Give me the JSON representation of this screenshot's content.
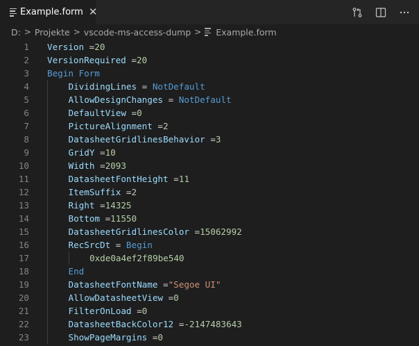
{
  "tab": {
    "label": "Example.form",
    "file_icon": "file-lines-icon",
    "close_icon": "close-icon"
  },
  "actions": [
    {
      "name": "compare-changes-icon"
    },
    {
      "name": "split-editor-icon"
    },
    {
      "name": "more-actions-icon"
    }
  ],
  "breadcrumb": {
    "items": [
      "D:",
      "Projekte",
      "vscode-ms-access-dump",
      "Example.form"
    ],
    "separator": ">"
  },
  "colors": {
    "key": "#9cdcfe",
    "number": "#b5cea8",
    "keyword": "#569cd6",
    "string": "#ce9178",
    "operator": "#d4d4d4",
    "line_number": "#858585"
  },
  "editor": {
    "lines": [
      {
        "n": "1",
        "indent": 0,
        "tokens": [
          {
            "t": "key",
            "v": "Version "
          },
          {
            "t": "op",
            "v": "="
          },
          {
            "t": "num",
            "v": "20"
          }
        ]
      },
      {
        "n": "2",
        "indent": 0,
        "tokens": [
          {
            "t": "key",
            "v": "VersionRequired "
          },
          {
            "t": "op",
            "v": "="
          },
          {
            "t": "num",
            "v": "20"
          }
        ]
      },
      {
        "n": "3",
        "indent": 0,
        "tokens": [
          {
            "t": "kw",
            "v": "Begin Form"
          }
        ]
      },
      {
        "n": "4",
        "indent": 1,
        "tokens": [
          {
            "t": "key",
            "v": "DividingLines "
          },
          {
            "t": "op",
            "v": "= "
          },
          {
            "t": "kw",
            "v": "NotDefault"
          }
        ]
      },
      {
        "n": "5",
        "indent": 1,
        "tokens": [
          {
            "t": "key",
            "v": "AllowDesignChanges "
          },
          {
            "t": "op",
            "v": "= "
          },
          {
            "t": "kw",
            "v": "NotDefault"
          }
        ]
      },
      {
        "n": "6",
        "indent": 1,
        "tokens": [
          {
            "t": "key",
            "v": "DefaultView "
          },
          {
            "t": "op",
            "v": "="
          },
          {
            "t": "num",
            "v": "0"
          }
        ]
      },
      {
        "n": "7",
        "indent": 1,
        "tokens": [
          {
            "t": "key",
            "v": "PictureAlignment "
          },
          {
            "t": "op",
            "v": "="
          },
          {
            "t": "num",
            "v": "2"
          }
        ]
      },
      {
        "n": "8",
        "indent": 1,
        "tokens": [
          {
            "t": "key",
            "v": "DatasheetGridlinesBehavior "
          },
          {
            "t": "op",
            "v": "="
          },
          {
            "t": "num",
            "v": "3"
          }
        ]
      },
      {
        "n": "9",
        "indent": 1,
        "tokens": [
          {
            "t": "key",
            "v": "GridY "
          },
          {
            "t": "op",
            "v": "="
          },
          {
            "t": "num",
            "v": "10"
          }
        ]
      },
      {
        "n": "10",
        "indent": 1,
        "tokens": [
          {
            "t": "key",
            "v": "Width "
          },
          {
            "t": "op",
            "v": "="
          },
          {
            "t": "num",
            "v": "2093"
          }
        ]
      },
      {
        "n": "11",
        "indent": 1,
        "tokens": [
          {
            "t": "key",
            "v": "DatasheetFontHeight "
          },
          {
            "t": "op",
            "v": "="
          },
          {
            "t": "num",
            "v": "11"
          }
        ]
      },
      {
        "n": "12",
        "indent": 1,
        "tokens": [
          {
            "t": "key",
            "v": "ItemSuffix "
          },
          {
            "t": "op",
            "v": "="
          },
          {
            "t": "num",
            "v": "2"
          }
        ]
      },
      {
        "n": "13",
        "indent": 1,
        "tokens": [
          {
            "t": "key",
            "v": "Right "
          },
          {
            "t": "op",
            "v": "="
          },
          {
            "t": "num",
            "v": "14325"
          }
        ]
      },
      {
        "n": "14",
        "indent": 1,
        "tokens": [
          {
            "t": "key",
            "v": "Bottom "
          },
          {
            "t": "op",
            "v": "="
          },
          {
            "t": "num",
            "v": "11550"
          }
        ]
      },
      {
        "n": "15",
        "indent": 1,
        "tokens": [
          {
            "t": "key",
            "v": "DatasheetGridlinesColor "
          },
          {
            "t": "op",
            "v": "="
          },
          {
            "t": "num",
            "v": "15062992"
          }
        ]
      },
      {
        "n": "16",
        "indent": 1,
        "tokens": [
          {
            "t": "key",
            "v": "RecSrcDt "
          },
          {
            "t": "op",
            "v": "= "
          },
          {
            "t": "kw",
            "v": "Begin"
          }
        ]
      },
      {
        "n": "17",
        "indent": 2,
        "tokens": [
          {
            "t": "num",
            "v": "0xde0a4ef2f89be540"
          }
        ]
      },
      {
        "n": "18",
        "indent": 1,
        "tokens": [
          {
            "t": "kw",
            "v": "End"
          }
        ]
      },
      {
        "n": "19",
        "indent": 1,
        "tokens": [
          {
            "t": "key",
            "v": "DatasheetFontName "
          },
          {
            "t": "op",
            "v": "="
          },
          {
            "t": "str",
            "v": "\"Segoe UI\""
          }
        ]
      },
      {
        "n": "20",
        "indent": 1,
        "tokens": [
          {
            "t": "key",
            "v": "AllowDatasheetView "
          },
          {
            "t": "op",
            "v": "="
          },
          {
            "t": "num",
            "v": "0"
          }
        ]
      },
      {
        "n": "21",
        "indent": 1,
        "tokens": [
          {
            "t": "key",
            "v": "FilterOnLoad "
          },
          {
            "t": "op",
            "v": "="
          },
          {
            "t": "num",
            "v": "0"
          }
        ]
      },
      {
        "n": "22",
        "indent": 1,
        "tokens": [
          {
            "t": "key",
            "v": "DatasheetBackColor12 "
          },
          {
            "t": "op",
            "v": "="
          },
          {
            "t": "num",
            "v": "-2147483643"
          }
        ]
      },
      {
        "n": "23",
        "indent": 1,
        "tokens": [
          {
            "t": "key",
            "v": "ShowPageMargins "
          },
          {
            "t": "op",
            "v": "="
          },
          {
            "t": "num",
            "v": "0"
          }
        ]
      }
    ]
  }
}
